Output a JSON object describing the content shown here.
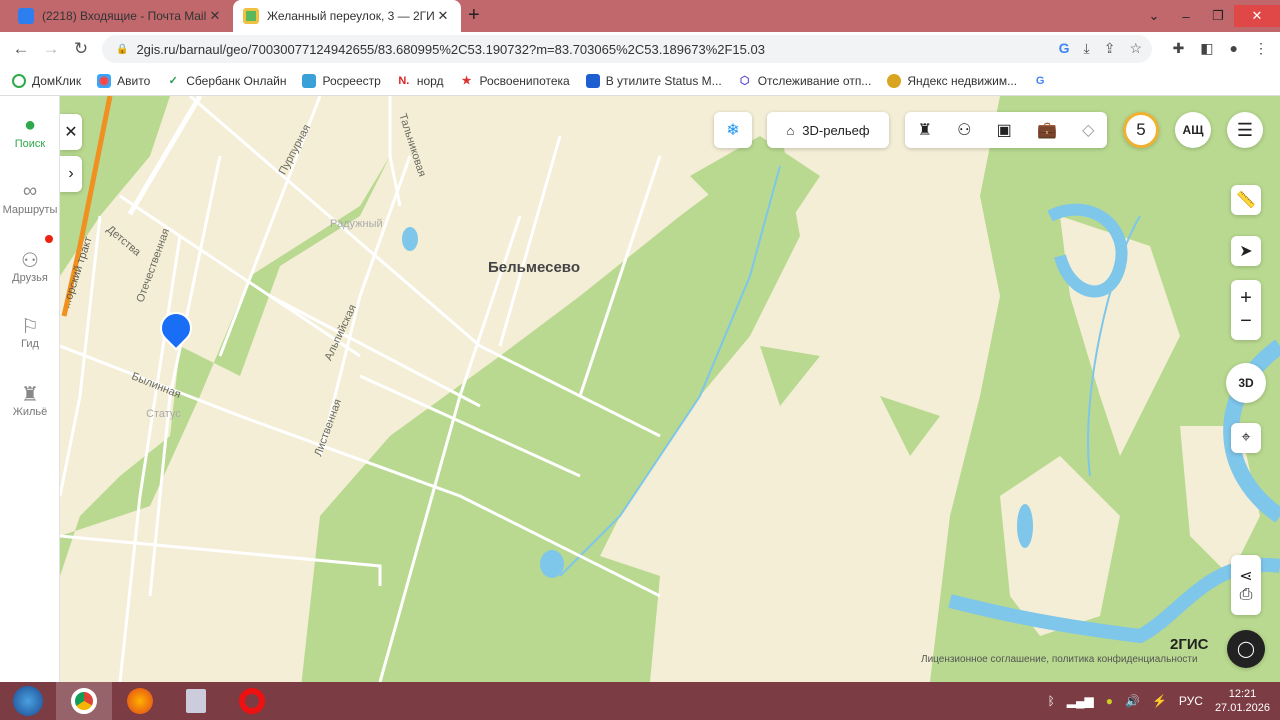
{
  "browser": {
    "tabs": [
      {
        "title": "(2218) Входящие - Почта Mail",
        "active": false
      },
      {
        "title": "Желанный переулок, 3 — 2ГИС",
        "active": true
      }
    ],
    "url": "2gis.ru/barnaul/geo/70030077124942655/83.680995%2C53.190732?m=83.703065%2C53.189673%2F15.03",
    "bookmarks": [
      "ДомКлик",
      "Авито",
      "Сбербанк Онлайн",
      "Росреестр",
      "норд",
      "Росвоенипотека",
      "В утилите Status M...",
      "Отслеживание отп...",
      "Яндекс недвижим..."
    ]
  },
  "sidebar": {
    "items": [
      {
        "label": "Поиск",
        "icon": "pin-icon",
        "active": true
      },
      {
        "label": "Маршруты",
        "icon": "route-icon"
      },
      {
        "label": "Друзья",
        "icon": "friends-icon",
        "badge": true
      },
      {
        "label": "Гид",
        "icon": "flag-icon"
      },
      {
        "label": "Жильё",
        "icon": "housing-icon"
      }
    ]
  },
  "map": {
    "relief_label": "3D-рельеф",
    "notifications": "5",
    "user_initials": "АЩ",
    "button_3d": "3D",
    "city_label": "Бельмесево",
    "district_label": "Радужный",
    "place_label": "Статус",
    "streets": [
      "Пурпурная",
      "Тальниковая",
      "Детства",
      "Отечественная",
      "Альпийская",
      "Былинная",
      "Лиственная",
      "...орский тракт"
    ],
    "brand": "2ГИС",
    "footer_link": "Лицензионное соглашение, политика конфиденциальности"
  },
  "taskbar": {
    "lang": "РУС",
    "time": "12:21",
    "date": "27.01.2026"
  }
}
